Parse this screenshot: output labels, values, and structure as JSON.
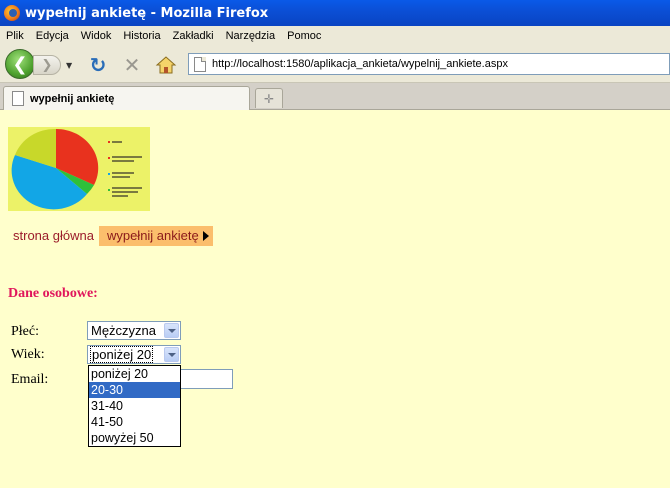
{
  "window": {
    "title": "wypełnij ankietę - Mozilla Firefox"
  },
  "menu": {
    "items": [
      "Plik",
      "Edycja",
      "Widok",
      "Historia",
      "Zakładki",
      "Narzędzia",
      "Pomoc"
    ]
  },
  "toolbar": {
    "url": "http://localhost:1580/aplikacja_ankieta/wypelnij_ankiete.aspx"
  },
  "tabs": [
    {
      "label": "wypełnij ankietę",
      "active": true
    }
  ],
  "page": {
    "nav": {
      "home_label": "strona główna",
      "active_label": "wypełnij ankietę"
    },
    "section_title": "Dane osobowe:",
    "form": {
      "gender_label": "Płeć:",
      "gender_value": "Mężczyzna",
      "age_label": "Wiek:",
      "age_value": "poniżej 20",
      "email_label": "Email:",
      "email_value": "",
      "age_options": [
        "poniżej 20",
        "20-30",
        "31-40",
        "41-50",
        "powyżej 50"
      ],
      "age_highlighted": "20-30"
    }
  },
  "colors": {
    "page_background": "#ffffcc",
    "section_title": "#e0165c",
    "nav_active_background": "#fbbe6c",
    "nav_text": "#9b1d2b",
    "dropdown_highlight": "#316ac5",
    "titlebar": "#0b4fd6"
  },
  "icons": {
    "back": "back-arrow-icon",
    "forward": "forward-arrow-icon",
    "reload": "reload-icon",
    "stop": "stop-icon",
    "home": "home-icon",
    "page": "page-icon",
    "new_tab": "new-tab-icon"
  }
}
